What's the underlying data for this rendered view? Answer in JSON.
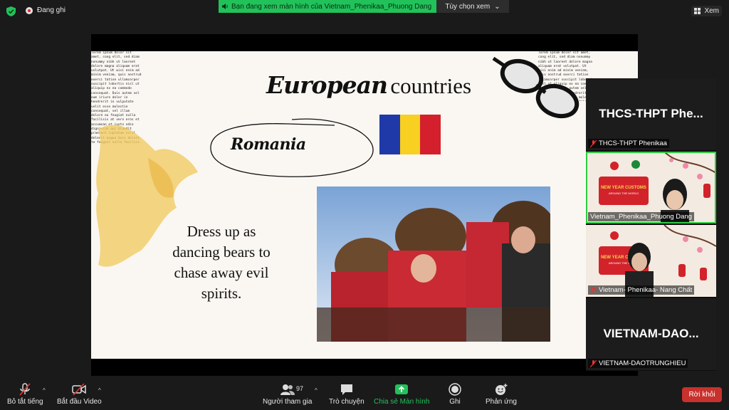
{
  "topbar": {
    "recording_label": "Đang ghi",
    "share_banner": "Bạn đang xem màn hình của Vietnam_Phenikaa_Phuong Dang",
    "view_options": "Tùy chọn xem",
    "view_button": "Xem"
  },
  "slide": {
    "title_script": "European",
    "title_plain": "countries",
    "country": "Romania",
    "caption": "Dress up as dancing bears to chase away evil spirits.",
    "flag_colors": [
      "#1f3aa8",
      "#f7d021",
      "#d4202c"
    ],
    "filler_text": "lorem ipsum dolor sit amet, cong elit, sed diam nonummy nibh ut laoreet dolore magna aliquam erat volutpat. Ut wisi enim ad minim veniam, quis nostrud exerci tation ullamcorper suscipit lobortis nisl ut aliquip ex ea commodo consequat. Duis autem vel eum iriure dolor in hendrerit in vulputate velit esse molestie consequat, vel illum dolore eu feugiat nulla facilisis at vero eros et accumsan et iusto odio dignissim qui blandit praesent luptatum zzril delenit augue duis dolore te feugait nulla facilisi."
  },
  "participants": [
    {
      "big_name": "THCS-THPT Phe...",
      "label": "THCS-THPT Phenikaa",
      "video": false
    },
    {
      "big_name": "",
      "label": "Vietnam_Phenikaa_Phuong Dang",
      "video": true
    },
    {
      "big_name": "",
      "label": "Vietnam- Phenikaa- Nang Chất",
      "video": true
    },
    {
      "big_name": "VIETNAM-DAO...",
      "label": "VIETNAM-DAOTRUNGHIEU",
      "video": false
    }
  ],
  "tile_banner": {
    "line1": "NEW YEAR CUSTOMS",
    "line2": "AROUND THE WORLD"
  },
  "toolbar": {
    "mute": "Bỏ tắt tiếng",
    "video": "Bắt đầu Video",
    "participants": "Người tham gia",
    "participant_count": "97",
    "chat": "Trò chuyện",
    "share": "Chia sẻ Màn hình",
    "record": "Ghi",
    "reactions": "Phản ứng",
    "leave": "Rời khỏi"
  }
}
